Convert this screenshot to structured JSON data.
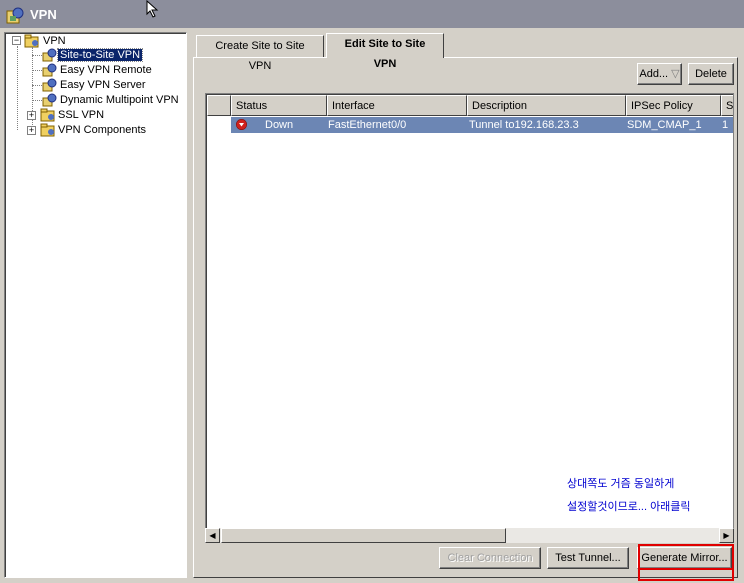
{
  "window": {
    "title": "VPN",
    "icon": "vpn-icon"
  },
  "tree": {
    "root": "VPN",
    "items": [
      {
        "label": "Site-to-Site VPN",
        "selected": true
      },
      {
        "label": "Easy VPN Remote"
      },
      {
        "label": "Easy VPN Server"
      },
      {
        "label": "Dynamic Multipoint VPN"
      },
      {
        "label": "SSL VPN",
        "expandable": true
      },
      {
        "label": "VPN Components",
        "expandable": true
      }
    ]
  },
  "tabs": [
    {
      "label": "Create Site to Site VPN"
    },
    {
      "label": "Edit Site to Site VPN",
      "active": true
    }
  ],
  "toolbar": {
    "add_label": "Add...",
    "delete_label": "Delete"
  },
  "table": {
    "columns": [
      "Status",
      "Interface",
      "Description",
      "IPSec Policy",
      "S"
    ],
    "rows": [
      {
        "status": "Down",
        "interface": "FastEthernet0/0",
        "description": "Tunnel to192.168.23.3",
        "ipsec_policy": "SDM_CMAP_1",
        "seq": "1"
      }
    ]
  },
  "note": {
    "line1": "상대쪽도 거즘 동일하게",
    "line2": "설정할것이므로... 아래클릭"
  },
  "buttons": {
    "clear_connection": "Clear Connection",
    "test_tunnel": "Test Tunnel...",
    "generate_mirror": "Generate Mirror..."
  },
  "colors": {
    "selection": "#0a246a",
    "row_highlight": "#6c86b4",
    "status_down": "#d0201c",
    "note_text": "#0000d0",
    "highlight_box": "#e00000"
  }
}
